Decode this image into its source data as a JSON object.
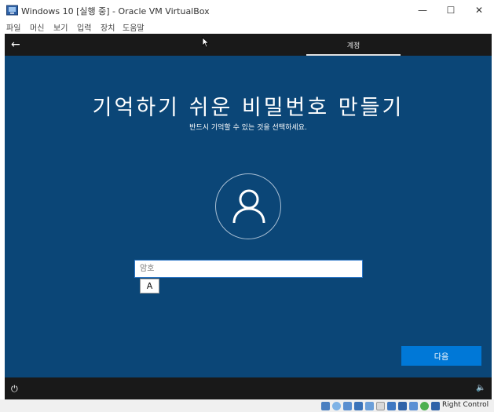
{
  "window": {
    "title": "Windows 10 [실행 중] - Oracle VM VirtualBox",
    "minimize_glyph": "—",
    "maximize_glyph": "☐",
    "close_glyph": "✕"
  },
  "menu": {
    "items": [
      "파일",
      "머신",
      "보기",
      "입력",
      "장치",
      "도움말"
    ]
  },
  "vm_top": {
    "back_glyph": "←",
    "tab_label": "계정"
  },
  "oobe": {
    "title": "기억하기 쉬운 비밀번호 만들기",
    "subtitle": "반드시 기억할 수 있는 것을 선택하세요.",
    "password_placeholder": "암호",
    "password_value": "",
    "ime_mode": "A",
    "next_label": "다음"
  },
  "vm_bottom": {
    "power_glyph": "⏻",
    "volume_glyph": "🔈"
  },
  "status": {
    "host_key": "Right Control",
    "icons": [
      "hard-disk-icon",
      "optical-drive-icon",
      "audio-icon",
      "network-icon",
      "usb-icon",
      "shared-folder-icon",
      "display-icon",
      "video-capture-icon",
      "virtualization-icon",
      "mouse-integration-icon",
      "keyboard-capture-icon"
    ]
  },
  "colors": {
    "oobe_background": "#0b4677",
    "accent": "#0078d7",
    "vm_strip": "#191919"
  }
}
